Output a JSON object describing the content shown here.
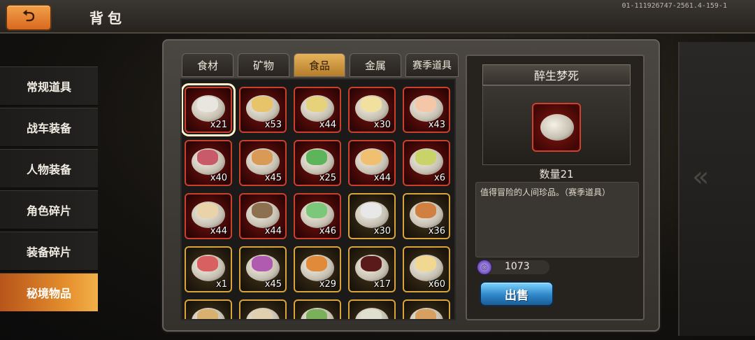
{
  "header": {
    "title": "背包",
    "back_icon": "return-arrow-icon",
    "build_id": "01-111926747-2561.4-159-1"
  },
  "sidebar": {
    "items": [
      {
        "label": "常规道具",
        "active": false
      },
      {
        "label": "战车装备",
        "active": false
      },
      {
        "label": "人物装备",
        "active": false
      },
      {
        "label": "角色碎片",
        "active": false
      },
      {
        "label": "装备碎片",
        "active": false
      },
      {
        "label": "秘境物品",
        "active": true
      }
    ]
  },
  "tabs": [
    {
      "label": "食材",
      "active": false
    },
    {
      "label": "矿物",
      "active": false
    },
    {
      "label": "食品",
      "active": true
    },
    {
      "label": "金属",
      "active": false
    },
    {
      "label": "赛季道具",
      "active": false
    }
  ],
  "items": [
    {
      "qty": "x21",
      "rarity": "red",
      "color": "#e9e6df",
      "selected": true
    },
    {
      "qty": "x53",
      "rarity": "red",
      "color": "#e7c36a"
    },
    {
      "qty": "x44",
      "rarity": "red",
      "color": "#e5d27a"
    },
    {
      "qty": "x30",
      "rarity": "red",
      "color": "#f1e0a0"
    },
    {
      "qty": "x43",
      "rarity": "red",
      "color": "#f6c6a8"
    },
    {
      "qty": "x40",
      "rarity": "red",
      "color": "#c85a6a"
    },
    {
      "qty": "x45",
      "rarity": "red",
      "color": "#d99a55"
    },
    {
      "qty": "x25",
      "rarity": "red",
      "color": "#5cb55a"
    },
    {
      "qty": "x44",
      "rarity": "red",
      "color": "#f0c070"
    },
    {
      "qty": "x6",
      "rarity": "red",
      "color": "#c8d468"
    },
    {
      "qty": "x44",
      "rarity": "red",
      "color": "#e8d4a8"
    },
    {
      "qty": "x44",
      "rarity": "red",
      "color": "#8c7050"
    },
    {
      "qty": "x46",
      "rarity": "red",
      "color": "#7cc87a"
    },
    {
      "qty": "x30",
      "rarity": "gold",
      "color": "#e8e8e8"
    },
    {
      "qty": "x36",
      "rarity": "gold",
      "color": "#d08040"
    },
    {
      "qty": "x1",
      "rarity": "gold",
      "color": "#d86060"
    },
    {
      "qty": "x45",
      "rarity": "gold",
      "color": "#b05ab0"
    },
    {
      "qty": "x29",
      "rarity": "gold",
      "color": "#e08a3a"
    },
    {
      "qty": "x17",
      "rarity": "gold",
      "color": "#5a1a1a"
    },
    {
      "qty": "x60",
      "rarity": "gold",
      "color": "#f0d890"
    },
    {
      "qty": "",
      "rarity": "gold",
      "color": "#d8b070"
    },
    {
      "qty": "",
      "rarity": "gold",
      "color": "#e0d0b0"
    },
    {
      "qty": "",
      "rarity": "gold",
      "color": "#7ab05a"
    },
    {
      "qty": "",
      "rarity": "gold",
      "color": "#e0e0d0"
    },
    {
      "qty": "",
      "rarity": "gold",
      "color": "#d8a060"
    }
  ],
  "detail": {
    "name": "醉生梦死",
    "count_label": "数量21",
    "description": "值得冒险的人间珍品。（赛季道具）",
    "price": "1073",
    "sell_label": "出售"
  },
  "colors": {
    "accent_orange": "#e6912e",
    "rarity_red": "#c9412c",
    "rarity_gold": "#d9a43a",
    "sell_blue": "#2f87c8"
  }
}
